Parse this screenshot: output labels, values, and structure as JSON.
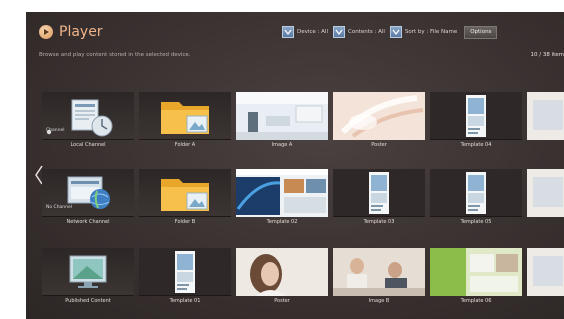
{
  "header": {
    "title": "Player",
    "subtitle": "Browse and play content stored in the selected device.",
    "count": "10 / 38 item"
  },
  "toolbar": {
    "device_label": "Device : All",
    "contents_label": "Contents : All",
    "sort_label": "Sort by : File Name",
    "options_label": "Options"
  },
  "colors": {
    "title_accent": "#f0b48a",
    "dropdown_blue": "#6d8db5",
    "background": "#3a3231"
  },
  "grid": {
    "rows": [
      [
        {
          "label": "Local Channel",
          "kind": "local-channel",
          "tag": "Channel"
        },
        {
          "label": "Folder A",
          "kind": "folder"
        },
        {
          "label": "Image A",
          "kind": "image-room"
        },
        {
          "label": "Poster",
          "kind": "image-feather"
        },
        {
          "label": "Template 04",
          "kind": "template-portrait"
        },
        {
          "label": "",
          "kind": "image-partial"
        }
      ],
      [
        {
          "label": "Network Channel",
          "kind": "network-channel",
          "tag": "No Channel"
        },
        {
          "label": "Folder B",
          "kind": "folder"
        },
        {
          "label": "Template 02",
          "kind": "template-wide"
        },
        {
          "label": "Template 03",
          "kind": "template-portrait"
        },
        {
          "label": "Template 05",
          "kind": "template-portrait"
        },
        {
          "label": "Ir",
          "kind": "image-partial"
        }
      ],
      [
        {
          "label": "Published Content",
          "kind": "published"
        },
        {
          "label": "Template 01",
          "kind": "template-portrait"
        },
        {
          "label": "Poster",
          "kind": "image-woman"
        },
        {
          "label": "Image B",
          "kind": "image-business"
        },
        {
          "label": "Template 06",
          "kind": "template-green"
        },
        {
          "label": "",
          "kind": "image-partial"
        }
      ]
    ]
  }
}
